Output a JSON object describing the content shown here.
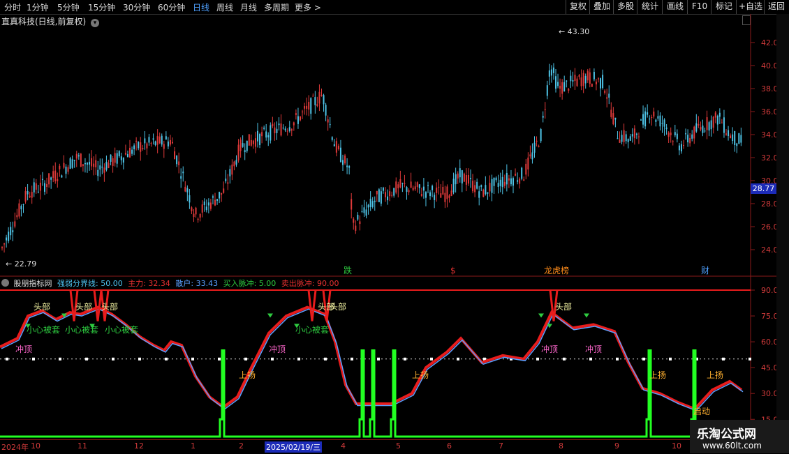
{
  "toolbar": {
    "periods": [
      "分时",
      "1分钟",
      "5分钟",
      "15分钟",
      "30分钟",
      "60分钟",
      "日线",
      "周线",
      "月线",
      "多周期",
      "更多 >"
    ],
    "active_period": "日线",
    "right_buttons": [
      "复权",
      "叠加",
      "多股",
      "统计",
      "画线",
      "F10",
      "标记",
      "+自选",
      "返回"
    ]
  },
  "title": {
    "stock": "直真科技(日线,前复权)",
    "dropdown_icon": "chevron-down-icon"
  },
  "price_panel": {
    "y_ticks": [
      "42.00",
      "40.00",
      "38.00",
      "36.00",
      "34.00",
      "32.00",
      "30.00",
      "28.00",
      "26.00",
      "24.00"
    ],
    "current_price": "28.77",
    "high_label": "43.30",
    "low_label": "22.79",
    "event_markers": [
      {
        "text": "跌",
        "color": "#2ecc40"
      },
      {
        "text": "$",
        "color": "#e03030"
      },
      {
        "text": "龙虎榜",
        "color": "#ff8c1a"
      },
      {
        "text": "财",
        "color": "#4ea0ff"
      }
    ]
  },
  "indicator_header": {
    "name": "股朋指标网",
    "items": [
      {
        "label": "强弱分界线: 50.00",
        "color": "#4ec3f0"
      },
      {
        "label": "主力: 32.34",
        "color": "#e83030"
      },
      {
        "label": "散户: 33.43",
        "color": "#5aa0ff"
      },
      {
        "label": "买入脉冲: 5.00",
        "color": "#2ecc40"
      },
      {
        "label": "卖出脉冲: 90.00",
        "color": "#e83030"
      }
    ]
  },
  "indicator_panel": {
    "y_ticks": [
      "90.00",
      "75.00",
      "60.00",
      "45.00",
      "30.00",
      "15.00"
    ],
    "annotations": [
      {
        "text": "头部",
        "color": "#f0f0a0"
      },
      {
        "text": "头部",
        "color": "#f0f0a0"
      },
      {
        "text": "头部",
        "color": "#f0f0a0"
      },
      {
        "text": "头部",
        "color": "#f0f0a0"
      },
      {
        "text": "头部",
        "color": "#f0f0a0"
      },
      {
        "text": "头部",
        "color": "#f0f0a0"
      },
      {
        "text": "小心被套",
        "color": "#2ecc40"
      },
      {
        "text": "小心被套",
        "color": "#2ecc40"
      },
      {
        "text": "小心被套",
        "color": "#2ecc40"
      },
      {
        "text": "小心被套",
        "color": "#2ecc40"
      },
      {
        "text": "冲顶",
        "color": "#ff66cc"
      },
      {
        "text": "冲顶",
        "color": "#ff66cc"
      },
      {
        "text": "冲顶",
        "color": "#ff66cc"
      },
      {
        "text": "冲顶",
        "color": "#ff66cc"
      },
      {
        "text": "上扬",
        "color": "#ffb030"
      },
      {
        "text": "上扬",
        "color": "#ffb030"
      },
      {
        "text": "上扬",
        "color": "#ffb030"
      },
      {
        "text": "上扬",
        "color": "#ffb030"
      },
      {
        "text": "启动",
        "color": "#ffb030"
      }
    ]
  },
  "date_axis": {
    "labels": [
      "2024年",
      "10",
      "11",
      "12",
      "1",
      "2",
      "2025/02/19/三",
      "4",
      "5",
      "6",
      "7",
      "8",
      "9",
      "10"
    ],
    "highlight": "2025/02/19/三"
  },
  "watermark": {
    "title": "乐淘公式网",
    "url": "www.60lt.com"
  },
  "colors": {
    "up": "#e03a3a",
    "down": "#4ec3e6",
    "main": "#e81c1c",
    "retail": "#5aa0ff",
    "pulse": "#22ff22",
    "sell": "#e81c1c"
  }
}
